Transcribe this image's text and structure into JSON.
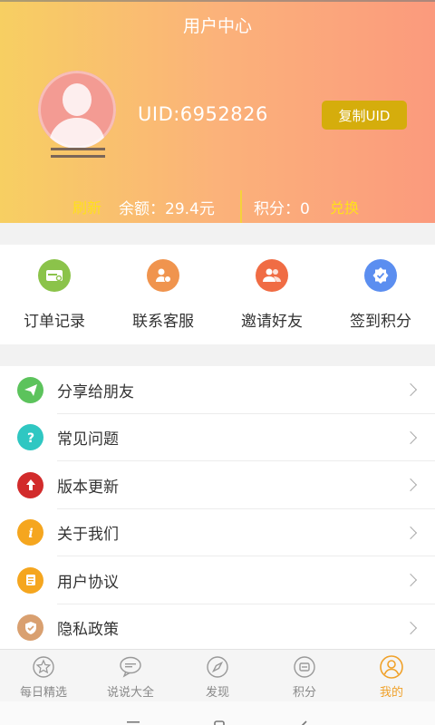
{
  "header": {
    "title": "用户中心",
    "uid_text": "UID:6952826",
    "copy_label": "复制UID",
    "refresh_label": "刷新",
    "balance_text": "余额：29.4元",
    "points_text": "积分：0",
    "exchange_label": "兑换"
  },
  "quick_actions": [
    {
      "label": "订单记录",
      "icon": "order-record-icon",
      "color": "#8bc34a"
    },
    {
      "label": "联系客服",
      "icon": "customer-service-icon",
      "color": "#f0944e"
    },
    {
      "label": "邀请好友",
      "icon": "invite-friends-icon",
      "color": "#f06c44"
    },
    {
      "label": "签到积分",
      "icon": "checkin-points-icon",
      "color": "#5b8ef0"
    }
  ],
  "menu": [
    {
      "label": "分享给朋友",
      "icon": "share-icon",
      "color": "#5cc35c"
    },
    {
      "label": "常见问题",
      "icon": "question-icon",
      "color": "#2fc7c2"
    },
    {
      "label": "版本更新",
      "icon": "update-icon",
      "color": "#d22b2b"
    },
    {
      "label": "关于我们",
      "icon": "info-icon",
      "color": "#f5a61f"
    },
    {
      "label": "用户协议",
      "icon": "agreement-icon",
      "color": "#f5a61f"
    },
    {
      "label": "隐私政策",
      "icon": "privacy-icon",
      "color": "#d9a070"
    }
  ],
  "tabs": [
    {
      "label": "每日精选",
      "icon": "star-icon"
    },
    {
      "label": "说说大全",
      "icon": "chat-icon"
    },
    {
      "label": "发现",
      "icon": "compass-icon"
    },
    {
      "label": "积分",
      "icon": "points-icon"
    },
    {
      "label": "我的",
      "icon": "user-icon",
      "active": true
    }
  ],
  "colors": {
    "accent": "#f0a12a",
    "gold_button": "#d5ad0c",
    "highlight": "#ffe11a"
  }
}
